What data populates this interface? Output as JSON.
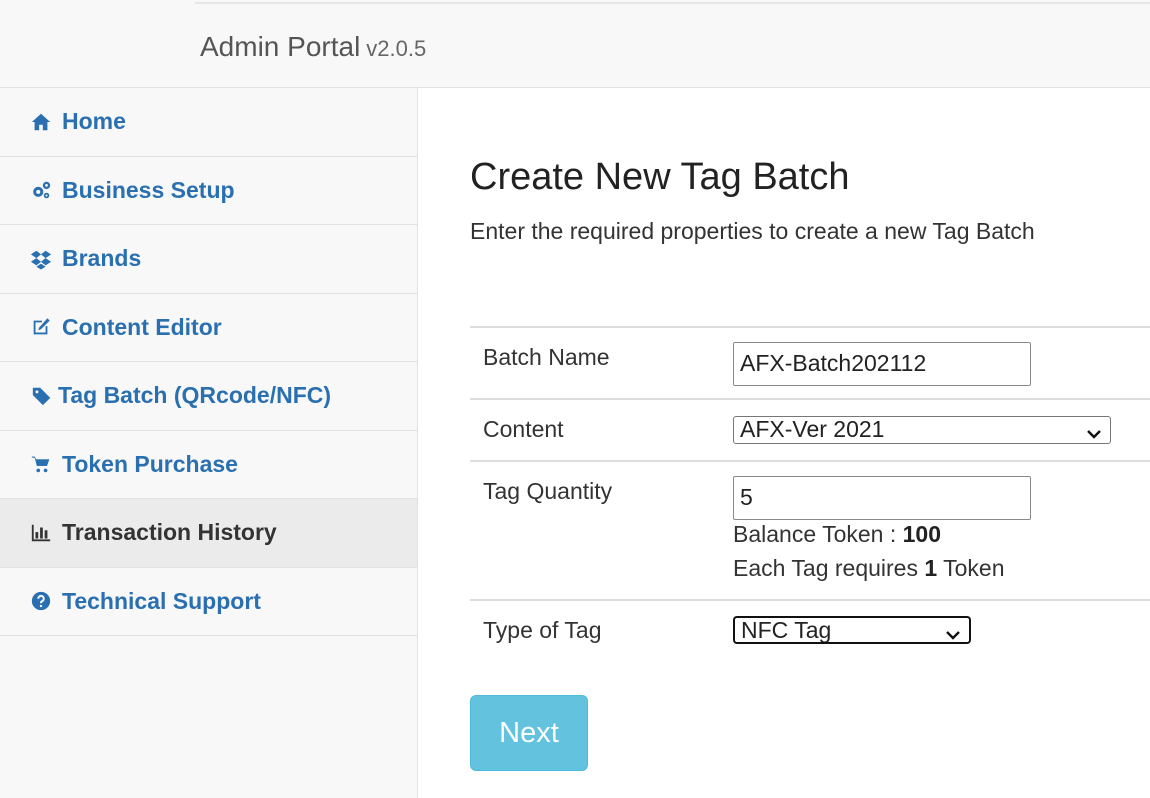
{
  "app": {
    "title": "Admin Portal",
    "version": "v2.0.5"
  },
  "sidebar": {
    "items": [
      {
        "label": "Home",
        "icon": "home-icon",
        "active": false
      },
      {
        "label": "Business Setup",
        "icon": "gears-icon",
        "active": false
      },
      {
        "label": "Brands",
        "icon": "dropbox-icon",
        "active": false
      },
      {
        "label": "Content Editor",
        "icon": "edit-icon",
        "active": false
      },
      {
        "label": "Tag Batch (QRcode/NFC)",
        "icon": "tags-icon",
        "active": false
      },
      {
        "label": "Token Purchase",
        "icon": "cart-icon",
        "active": false
      },
      {
        "label": "Transaction History",
        "icon": "bar-chart-icon",
        "active": true
      },
      {
        "label": "Technical Support",
        "icon": "question-circle-icon",
        "active": false
      }
    ]
  },
  "main": {
    "title": "Create New Tag Batch",
    "subtitle": "Enter the required properties to create a new Tag Batch",
    "form": {
      "batch_name": {
        "label": "Batch Name",
        "value": "AFX-Batch202112"
      },
      "content": {
        "label": "Content",
        "selected": "AFX-Ver 2021"
      },
      "tag_quantity": {
        "label": "Tag Quantity",
        "value": "5",
        "balance_label": "Balance Token : ",
        "balance_value": "100",
        "each_prefix": "Each Tag requires ",
        "each_value": "1",
        "each_suffix": " Token"
      },
      "type_of_tag": {
        "label": "Type of Tag",
        "selected": "NFC Tag"
      }
    },
    "next_label": "Next"
  },
  "colors": {
    "link": "#2a6fb0",
    "button": "#5bc0de",
    "sidebar_bg": "#f8f8f8",
    "active_bg": "#ebebeb"
  }
}
